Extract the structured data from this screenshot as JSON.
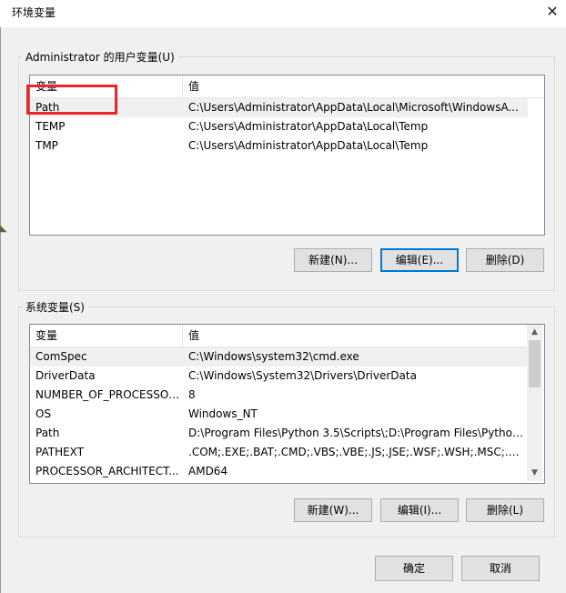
{
  "window": {
    "title": "环境变量",
    "close_glyph": "✕"
  },
  "user_vars": {
    "group_label": "Administrator 的用户变量(U)",
    "columns": [
      "变量",
      "值"
    ],
    "rows": [
      {
        "name": "Path",
        "value": "C:\\Users\\Administrator\\AppData\\Local\\Microsoft\\WindowsA..."
      },
      {
        "name": "TEMP",
        "value": "C:\\Users\\Administrator\\AppData\\Local\\Temp"
      },
      {
        "name": "TMP",
        "value": "C:\\Users\\Administrator\\AppData\\Local\\Temp"
      }
    ],
    "buttons": {
      "new": "新建(N)...",
      "edit": "编辑(E)...",
      "delete": "删除(D)"
    }
  },
  "system_vars": {
    "group_label": "系统变量(S)",
    "columns": [
      "变量",
      "值"
    ],
    "rows": [
      {
        "name": "ComSpec",
        "value": "C:\\Windows\\system32\\cmd.exe"
      },
      {
        "name": "DriverData",
        "value": "C:\\Windows\\System32\\Drivers\\DriverData"
      },
      {
        "name": "NUMBER_OF_PROCESSORS",
        "value": "8"
      },
      {
        "name": "OS",
        "value": "Windows_NT"
      },
      {
        "name": "Path",
        "value": "D:\\Program Files\\Python 3.5\\Scripts\\;D:\\Program Files\\Python..."
      },
      {
        "name": "PATHEXT",
        "value": ".COM;.EXE;.BAT;.CMD;.VBS;.VBE;.JS;.JSE;.WSF;.WSH;.MSC;.PY;.P..."
      },
      {
        "name": "PROCESSOR_ARCHITECT...",
        "value": "AMD64"
      }
    ],
    "buttons": {
      "new": "新建(W)...",
      "edit": "编辑(I)...",
      "delete": "删除(L)"
    }
  },
  "footer": {
    "ok": "确定",
    "cancel": "取消"
  },
  "icons": {
    "scroll_up": "▲",
    "scroll_down": "▼"
  },
  "colors": {
    "highlight": "#e8262b",
    "focus": "#0078d7"
  }
}
